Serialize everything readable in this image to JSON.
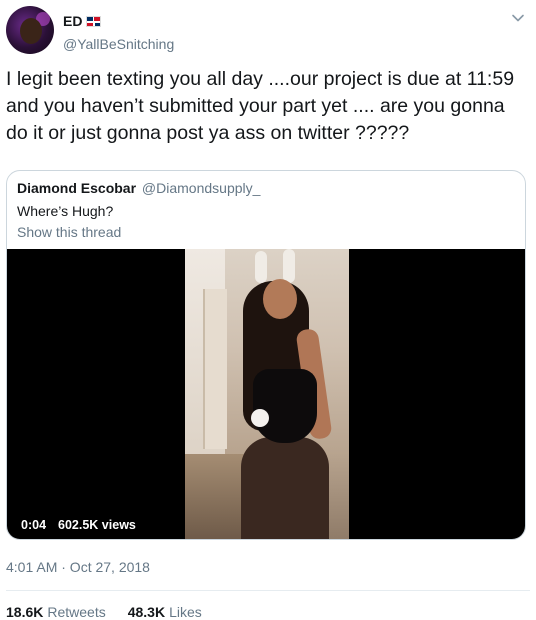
{
  "tweet": {
    "author": {
      "display_name": "ED",
      "handle": "@YallBeSnitching",
      "flag_icon": "dominican-republic-flag-icon"
    },
    "text": "I legit been texting you all day ....our project is due at 11:59\nand you haven’t submitted your part yet .... are you gonna\ndo it or just gonna post ya ass on twitter ?????",
    "menu_icon": "chevron-down-icon",
    "timestamp": "4:01 AM · Oct 27, 2018",
    "stats": {
      "retweets_count": "18.6K",
      "retweets_label": "Retweets",
      "likes_count": "48.3K",
      "likes_label": "Likes"
    }
  },
  "quoted_tweet": {
    "display_name": "Diamond Escobar",
    "handle": "@Diamondsupply_",
    "text": "Where’s Hugh?",
    "show_thread_label": "Show this thread",
    "video": {
      "duration": "0:04",
      "views": "602.5K views"
    }
  },
  "colors": {
    "text_primary": "#14171a",
    "text_secondary": "#657786",
    "border": "#ccd6dd"
  }
}
